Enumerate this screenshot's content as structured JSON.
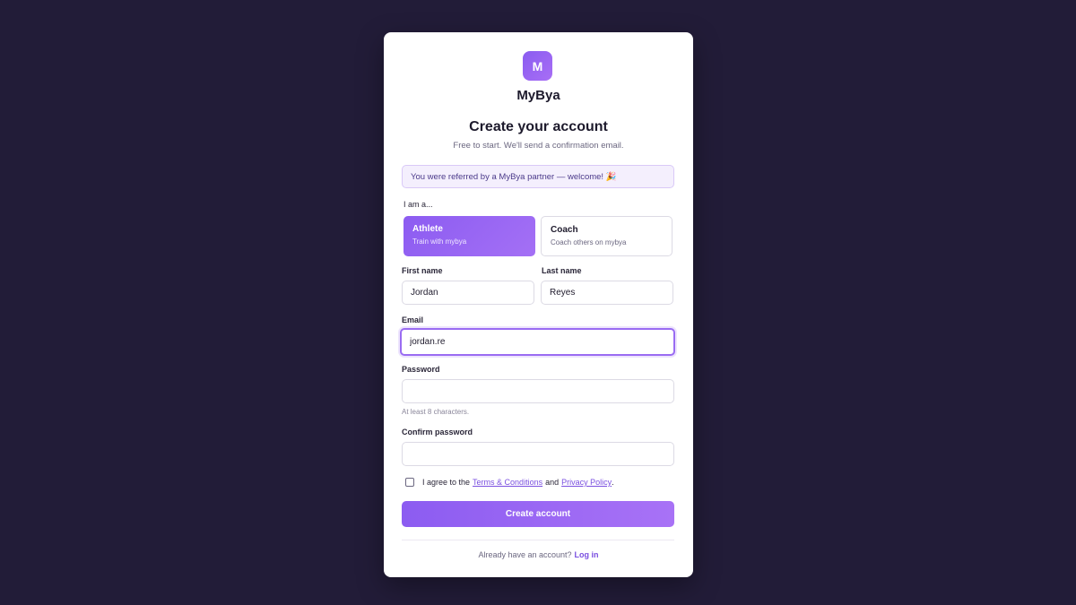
{
  "brand": {
    "logo_letter": "M",
    "name": "MyBya"
  },
  "header": {
    "title": "Create your account",
    "subtitle": "Free to start. We'll send a confirmation email."
  },
  "referral_banner": "You were referred by a MyBya partner — welcome! 🎉",
  "role": {
    "label": "I am a...",
    "options": [
      {
        "title": "Athlete",
        "subtitle": "Train with mybya",
        "selected": true
      },
      {
        "title": "Coach",
        "subtitle": "Coach others on mybya",
        "selected": false
      }
    ]
  },
  "form": {
    "first_name": {
      "label": "First name",
      "value": "Jordan"
    },
    "last_name": {
      "label": "Last name",
      "value": "Reyes"
    },
    "email": {
      "label": "Email",
      "value": "jordan.re"
    },
    "password": {
      "label": "Password",
      "value": "",
      "hint": "At least 8 characters."
    },
    "confirm_password": {
      "label": "Confirm password",
      "value": ""
    }
  },
  "agreement": {
    "prefix": "I agree to the",
    "terms_link": "Terms & Conditions",
    "joiner": "and",
    "privacy_link": "Privacy Policy",
    "suffix": ".",
    "checked": false
  },
  "submit_label": "Create account",
  "footer": {
    "prompt": "Already have an account?",
    "login_link": "Log in"
  },
  "colors": {
    "accent": "#8c5cf1",
    "background": "#221c38",
    "link": "#7a4fe0"
  }
}
